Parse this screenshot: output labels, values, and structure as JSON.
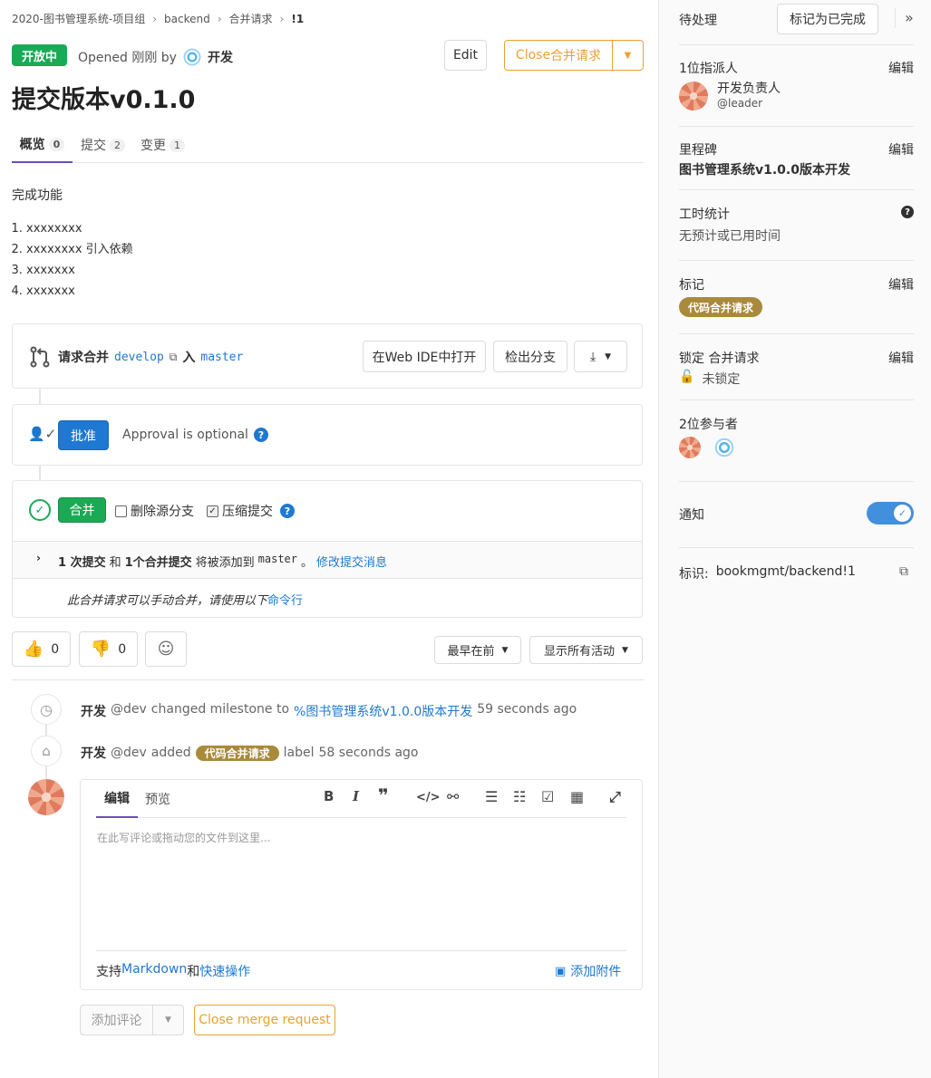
{
  "breadcrumb": {
    "group": "2020-图书管理系统-项目组",
    "project": "backend",
    "section": "合并请求",
    "current": "!1"
  },
  "header": {
    "status": "开放中",
    "opened": "Opened 刚刚 by",
    "author": "开发",
    "edit": "Edit",
    "close_prefix": "Close ",
    "close_suffix": "合并请求",
    "title": "提交版本v0.1.0"
  },
  "tabs": [
    {
      "label": "概览",
      "count": "0"
    },
    {
      "label": "提交",
      "count": "2"
    },
    {
      "label": "变更",
      "count": "1"
    }
  ],
  "description": {
    "intro": "完成功能",
    "items": [
      "xxxxxxxx",
      "xxxxxxxx 引入依赖",
      "xxxxxxx",
      "xxxxxxx"
    ]
  },
  "merge_widget": {
    "request_label": "请求合并",
    "source": "develop",
    "into": "入",
    "target": "master",
    "web_ide": "在Web IDE中打开",
    "checkout": "检出分支",
    "approve": "批准",
    "approval_text": "Approval is optional",
    "merge": "合并",
    "delete_source": "删除源分支",
    "squash": "压缩提交",
    "commits_count": "1 次提交",
    "and": "和",
    "merge_commit": "1个合并提交",
    "added_to": "将被添加到",
    "added_target": "master",
    "period": "。",
    "modify_msg": "修改提交消息",
    "manual_merge": "此合并请求可以手动合并，请使用以下",
    "command_line": "命令行"
  },
  "reactions": {
    "thumbs_up": "0",
    "thumbs_down": "0",
    "sort": "最早在前",
    "filter": "显示所有活动"
  },
  "activity": [
    {
      "user": "开发",
      "handle": "@dev",
      "text": "changed milestone to",
      "link": "%图书管理系统v1.0.0版本开发",
      "time": "59 seconds ago"
    },
    {
      "user": "开发",
      "handle": "@dev",
      "text": "added",
      "label": "代码合并请求",
      "suffix": "label",
      "time": "58 seconds ago"
    }
  ],
  "comment": {
    "tab_write": "编辑",
    "tab_preview": "预览",
    "placeholder": "在此写评论或拖动您的文件到这里...",
    "markdown_prefix": "支持",
    "markdown": "Markdown",
    "and": "和",
    "quick_actions": "快速操作",
    "attach": "添加附件",
    "add_comment": "添加评论",
    "close_mr": "Close merge request"
  },
  "sidebar": {
    "todo": "待处理",
    "mark_done": "标记为已完成",
    "assignee_title": "1位指派人",
    "edit": "编辑",
    "assignee_name": "开发负责人",
    "assignee_handle": "@leader",
    "milestone_title": "里程碑",
    "milestone_value": "图书管理系统v1.0.0版本开发",
    "time_title": "工时统计",
    "time_value": "无预计或已用时间",
    "labels_title": "标记",
    "label_value": "代码合并请求",
    "lock_title": "锁定 合并请求",
    "lock_value": "未锁定",
    "participants_title": "2位参与者",
    "notifications": "通知",
    "reference_label": "标识:",
    "reference_value": "bookmgmt/backend!1"
  },
  "colors": {
    "success": "#1aaa55",
    "primary": "#1f78d1",
    "warning": "#e9a131",
    "label": "#a98a3c",
    "toggle": "#428fdc"
  }
}
